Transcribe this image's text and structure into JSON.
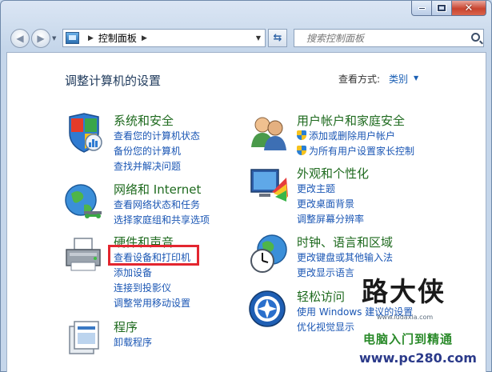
{
  "address": {
    "location": "控制面板"
  },
  "search": {
    "placeholder": "搜索控制面板"
  },
  "content": {
    "heading": "调整计算机的设置",
    "view_by_label": "查看方式:",
    "view_by_value": "类别"
  },
  "categories": {
    "system": {
      "title": "系统和安全",
      "links": [
        "查看您的计算机状态",
        "备份您的计算机",
        "查找并解决问题"
      ]
    },
    "network": {
      "title": "网络和 Internet",
      "links": [
        "查看网络状态和任务",
        "选择家庭组和共享选项"
      ]
    },
    "hardware": {
      "title": "硬件和声音",
      "links": [
        "查看设备和打印机",
        "添加设备",
        "连接到投影仪",
        "调整常用移动设置"
      ]
    },
    "programs": {
      "title": "程序",
      "links": [
        "卸载程序"
      ]
    },
    "users": {
      "title": "用户帐户和家庭安全",
      "links": [
        "添加或删除用户帐户",
        "为所有用户设置家长控制"
      ]
    },
    "appearance": {
      "title": "外观和个性化",
      "links": [
        "更改主题",
        "更改桌面背景",
        "调整屏幕分辨率"
      ]
    },
    "clock": {
      "title": "时钟、语言和区域",
      "links": [
        "更改键盘或其他输入法",
        "更改显示语言"
      ]
    },
    "ease": {
      "title": "轻松访问",
      "links": [
        "使用 Windows 建议的设置",
        "优化视觉显示"
      ]
    }
  },
  "watermark": {
    "brand": "路大侠",
    "url": "www.ludaxia.com",
    "slogan": "电脑入门到精通",
    "site": "www.pc280.com"
  },
  "colors": {
    "highlight_box": "#e3262f",
    "link": "#1a56b4",
    "category_title": "#1e6a1e"
  }
}
